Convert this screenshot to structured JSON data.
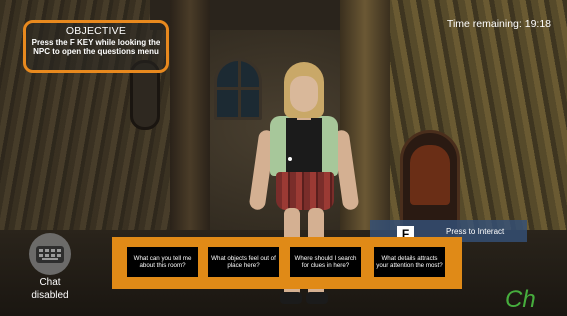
{
  "objective": {
    "title": "OBJECTIVE",
    "text": "Press the F KEY while looking the NPC to open the questions menu"
  },
  "timer": {
    "text": "Time remaining: 19:18"
  },
  "interact_prompt": {
    "key": "F",
    "label": "Press to Interact"
  },
  "questions": [
    "What can you tell me about this room?",
    "What objects feel out of place here?",
    "Where should I search for clues in here?",
    "What details attracts your attention the most?"
  ],
  "chat": {
    "icon": "keyboard-icon",
    "status_line1": "Chat",
    "status_line2": "disabled"
  },
  "colors": {
    "accent_orange": "#e08a17",
    "objective_border": "#e8891e",
    "interact_bg": "#345078",
    "button_bg": "#000000"
  }
}
